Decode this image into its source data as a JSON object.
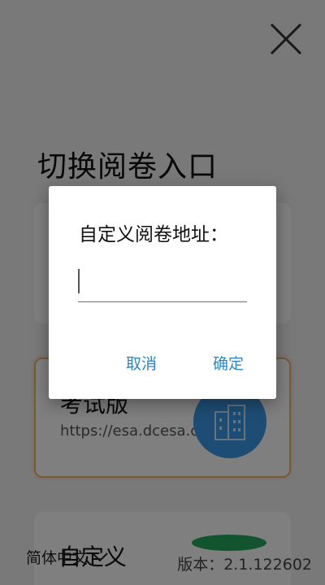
{
  "page": {
    "title": "切换阅卷入口",
    "close_icon": "close-icon"
  },
  "cards": {
    "exam": {
      "name": "考试版",
      "url": "https://esa.dcesa.cn",
      "icon": "building-icon",
      "accent": "#f0b46a",
      "badge_color": "#3a9be8"
    },
    "custom": {
      "name": "自定义",
      "badge_color": "#22a85c"
    }
  },
  "footer": {
    "language": "简体中文",
    "language_icon": "chevron-down-icon",
    "version": "版本：2.1.122602"
  },
  "dialog": {
    "title": "自定义阅卷地址：",
    "input_value": "",
    "input_placeholder": "",
    "cancel_label": "取消",
    "confirm_label": "确定",
    "button_color": "#2a86c9"
  }
}
